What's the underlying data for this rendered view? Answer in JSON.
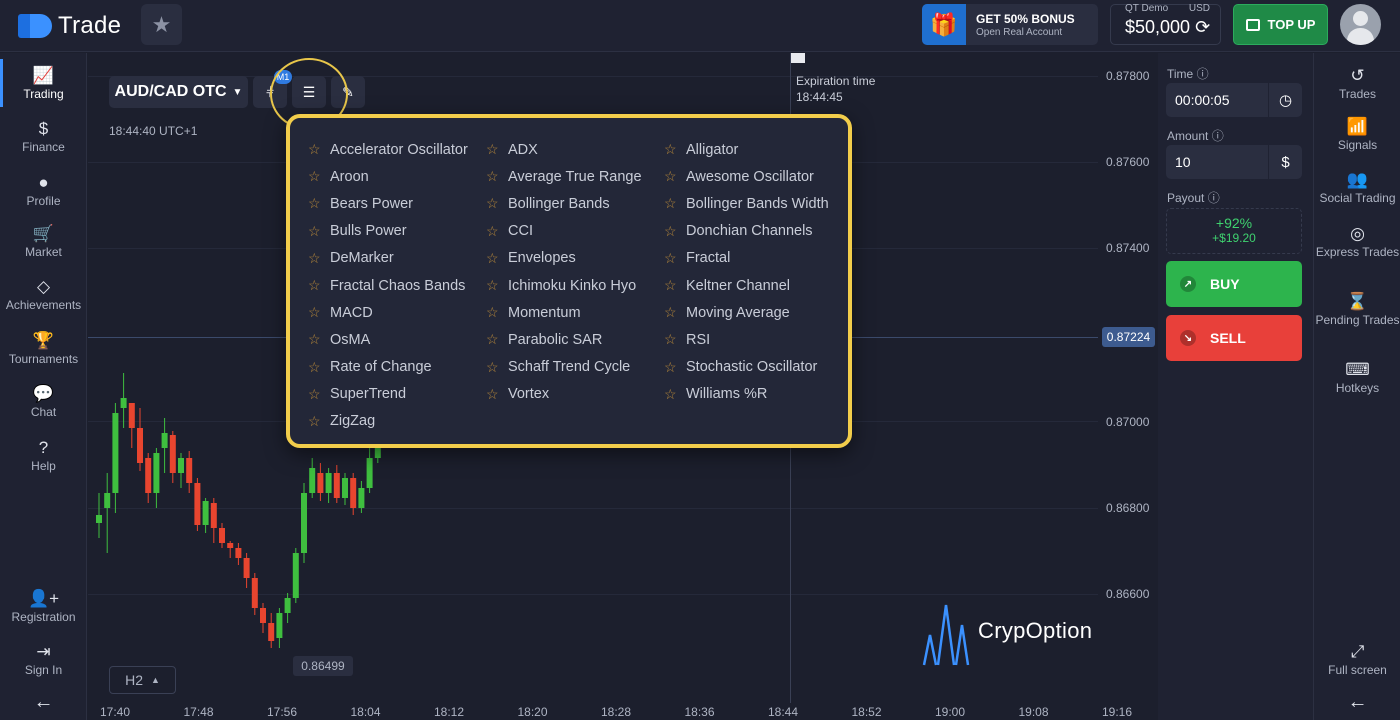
{
  "topbar": {
    "logo_text": "Trade",
    "bonus_title": "GET 50% BONUS",
    "bonus_sub": "Open Real Account",
    "account_label": "QT Demo",
    "currency": "USD",
    "balance": "$50,000",
    "topup_label": "TOP UP"
  },
  "leftnav": [
    {
      "label": "Trading",
      "icon": "chart-line-icon"
    },
    {
      "label": "Finance",
      "icon": "dollar-icon"
    },
    {
      "label": "Profile",
      "icon": "user-icon"
    },
    {
      "label": "Market",
      "icon": "cart-icon"
    },
    {
      "label": "Achievements",
      "icon": "diamond-icon"
    },
    {
      "label": "Tournaments",
      "icon": "trophy-icon"
    },
    {
      "label": "Chat",
      "icon": "chat-icon"
    },
    {
      "label": "Help",
      "icon": "help-icon"
    },
    {
      "label": "Registration",
      "icon": "user-plus-icon"
    },
    {
      "label": "Sign In",
      "icon": "sign-in-icon"
    }
  ],
  "rightnav": [
    {
      "label": "Trades",
      "icon": "history-icon"
    },
    {
      "label": "Signals",
      "icon": "signal-icon"
    },
    {
      "label": "Social Trading",
      "icon": "people-icon"
    },
    {
      "label": "Express Trades",
      "icon": "target-icon"
    },
    {
      "label": "Pending Trades",
      "icon": "hourglass-icon"
    },
    {
      "label": "Hotkeys",
      "icon": "keyboard-icon"
    },
    {
      "label": "Full screen",
      "icon": "fullscreen-icon"
    }
  ],
  "chart": {
    "pair": "AUD/CAD OTC",
    "timeframe_badge": "M1",
    "clock": "18:44:40 UTC+1",
    "expiration_label": "Expiration time",
    "expiration_time": "18:44:45",
    "current_price": "0.87224",
    "low_label": "0.86499",
    "timeframe": "H2",
    "watermark": "CrypOption",
    "price_labels": [
      "0.87800",
      "0.87600",
      "0.87400",
      "0.87000",
      "0.86800",
      "0.86600"
    ],
    "time_labels": [
      "17:40",
      "17:48",
      "17:56",
      "18:04",
      "18:12",
      "18:20",
      "18:28",
      "18:36",
      "18:44",
      "18:52",
      "19:00",
      "19:08",
      "19:16"
    ]
  },
  "chart_data": {
    "type": "candlestick",
    "pair": "AUD/CAD OTC",
    "current_price": 0.87224,
    "low": 0.86499,
    "ylim": [
      0.8645,
      0.8785
    ]
  },
  "indicators": {
    "col1": [
      "Accelerator Oscillator",
      "Aroon",
      "Bears Power",
      "Bulls Power",
      "DeMarker",
      "Fractal Chaos Bands",
      "MACD",
      "OsMA",
      "Rate of Change",
      "SuperTrend",
      "ZigZag"
    ],
    "col2": [
      "ADX",
      "Average True Range",
      "Bollinger Bands",
      "CCI",
      "Envelopes",
      "Ichimoku Kinko Hyo",
      "Momentum",
      "Parabolic SAR",
      "Schaff Trend Cycle",
      "Vortex"
    ],
    "col3": [
      "Alligator",
      "Awesome Oscillator",
      "Bollinger Bands Width",
      "Donchian Channels",
      "Fractal",
      "Keltner Channel",
      "Moving Average",
      "RSI",
      "Stochastic Oscillator",
      "Williams %R"
    ]
  },
  "panel": {
    "time_label": "Time",
    "time_value": "00:00:05",
    "amount_label": "Amount",
    "amount_value": "10",
    "payout_label": "Payout",
    "payout_pct": "+92%",
    "payout_amount": "+$19.20",
    "buy_label": "BUY",
    "sell_label": "SELL"
  },
  "colors": {
    "accent": "#3b91ff",
    "buy": "#2db44d",
    "sell": "#e8403a",
    "highlight": "#f2cd4b",
    "candle_up": "#3fbf3f",
    "candle_down": "#e8452f"
  }
}
